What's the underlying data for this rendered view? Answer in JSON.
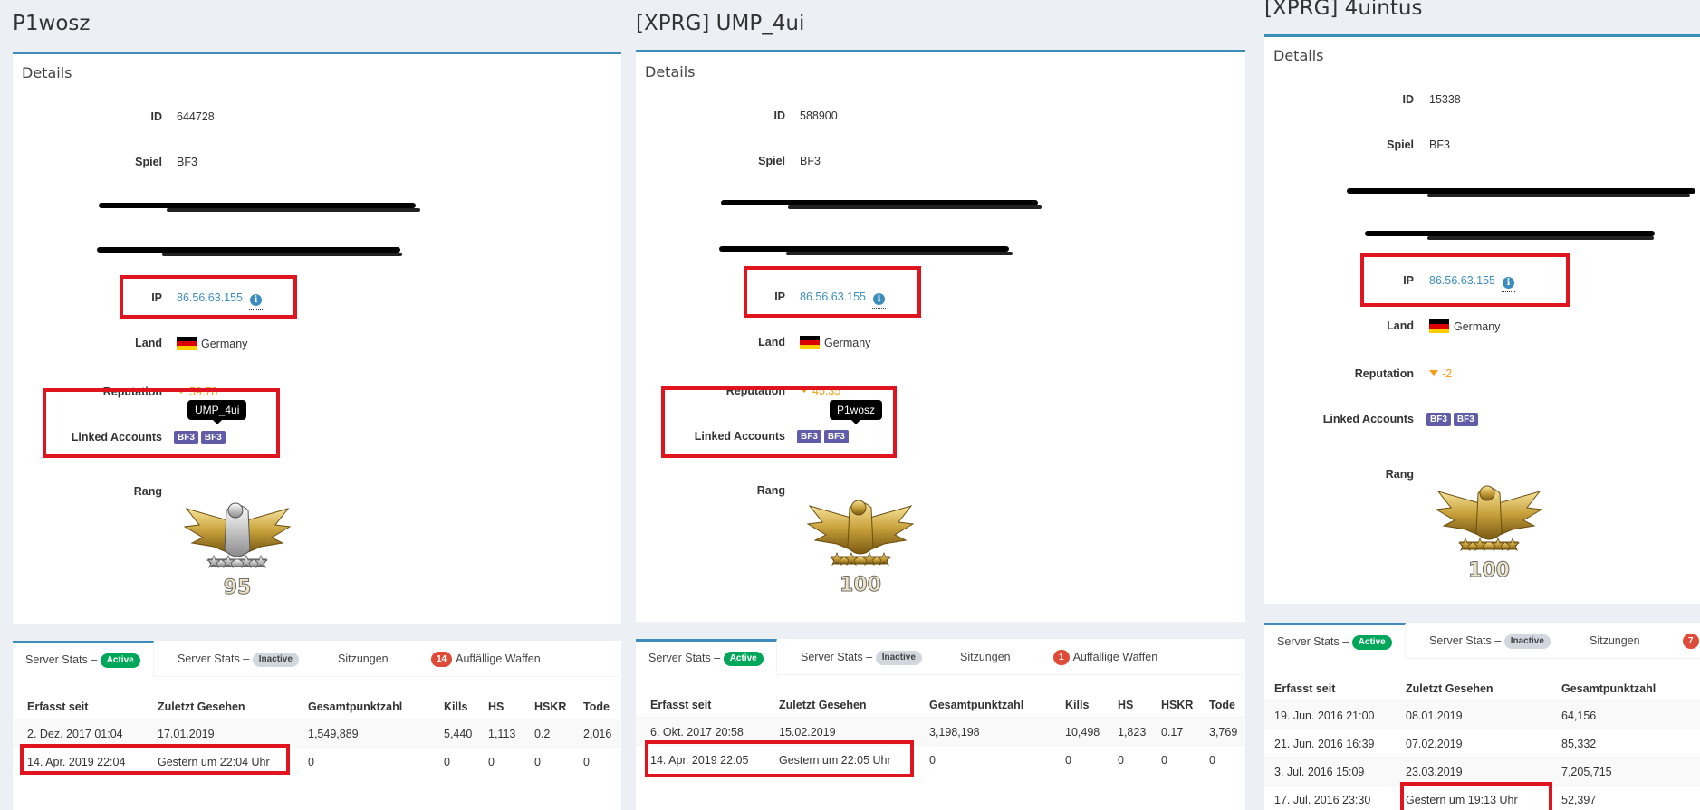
{
  "columns": [
    {
      "title": "P1wosz",
      "details_title": "Details",
      "labels": {
        "id": "ID",
        "game": "Spiel",
        "ip": "IP",
        "country": "Land",
        "reputation": "Reputation",
        "linked": "Linked Accounts",
        "rank": "Rang"
      },
      "id": "644728",
      "game": "BF3",
      "ip": "86.56.63.155",
      "country": "Germany",
      "reputation": "59.78",
      "linked_badges": [
        "BF3",
        "BF3"
      ],
      "tooltip": "UMP_4ui",
      "rank": "95",
      "tabs": [
        {
          "text": "Server Stats –",
          "label": "Active"
        },
        {
          "text": "Server Stats –",
          "label": "Inactive"
        },
        {
          "text": "Sitzungen"
        },
        {
          "count": "14",
          "text": "Auffällige Waffen"
        }
      ],
      "table_headers": [
        "Erfasst seit",
        "Zuletzt Gesehen",
        "Gesamtpunktzahl",
        "Kills",
        "HS",
        "HSKR",
        "Tode"
      ],
      "rows": [
        [
          "2. Dez. 2017 01:04",
          "17.01.2019",
          "1,549,889",
          "5,440",
          "1,113",
          "0.2",
          "2,016"
        ],
        [
          "14. Apr. 2019 22:04",
          "Gestern um 22:04 Uhr",
          "0",
          "0",
          "0",
          "0",
          "0"
        ]
      ]
    },
    {
      "title": "[XPRG] UMP_4ui",
      "details_title": "Details",
      "labels": {
        "id": "ID",
        "game": "Spiel",
        "ip": "IP",
        "country": "Land",
        "reputation": "Reputation",
        "linked": "Linked Accounts",
        "rank": "Rang"
      },
      "id": "588900",
      "game": "BF3",
      "ip": "86.56.63.155",
      "country": "Germany",
      "reputation": "45.35",
      "linked_badges": [
        "BF3",
        "BF3"
      ],
      "tooltip": "P1wosz",
      "rank": "100",
      "tabs": [
        {
          "text": "Server Stats –",
          "label": "Active"
        },
        {
          "text": "Server Stats –",
          "label": "Inactive"
        },
        {
          "text": "Sitzungen"
        },
        {
          "count": "1",
          "text": "Auffällige Waffen"
        }
      ],
      "table_headers": [
        "Erfasst seit",
        "Zuletzt Gesehen",
        "Gesamtpunktzahl",
        "Kills",
        "HS",
        "HSKR",
        "Tode"
      ],
      "rows": [
        [
          "6. Okt. 2017 20:58",
          "15.02.2019",
          "3,198,198",
          "10,498",
          "1,823",
          "0.17",
          "3,769"
        ],
        [
          "14. Apr. 2019 22:05",
          "Gestern um 22:05 Uhr",
          "0",
          "0",
          "0",
          "0",
          "0"
        ]
      ]
    },
    {
      "title": "[XPRG] 4uintus",
      "details_title": "Details",
      "labels": {
        "id": "ID",
        "game": "Spiel",
        "ip": "IP",
        "country": "Land",
        "reputation": "Reputation",
        "linked": "Linked Accounts",
        "rank": "Rang"
      },
      "id": "15338",
      "game": "BF3",
      "ip": "86.56.63.155",
      "country": "Germany",
      "reputation": "-2",
      "linked_badges": [
        "BF3",
        "BF3"
      ],
      "rank": "100",
      "tabs": [
        {
          "text": "Server Stats –",
          "label": "Active"
        },
        {
          "text": "Server Stats –",
          "label": "Inactive"
        },
        {
          "text": "Sitzungen"
        },
        {
          "count": "7"
        }
      ],
      "table_headers": [
        "Erfasst seit",
        "Zuletzt Gesehen",
        "Gesamtpunktzahl"
      ],
      "rows": [
        [
          "19. Jun. 2016 21:00",
          "08.01.2019",
          "64,156"
        ],
        [
          "21. Jun. 2016 16:39",
          "07.02.2019",
          "85,332"
        ],
        [
          "3. Jul. 2016 15:09",
          "23.03.2019",
          "7,205,715"
        ],
        [
          "17. Jul. 2016 23:30",
          "Gestern um 19:13 Uhr",
          "52,397"
        ]
      ]
    }
  ],
  "colors": {
    "accent": "#3c8dbc",
    "highlight": "#e0141e",
    "badge": "#605ca8",
    "active": "#00a65a",
    "inactive": "#d2d6de",
    "danger": "#dd4b39",
    "warning": "#f39c12"
  },
  "icons": [
    "info-icon",
    "germany-flag-icon",
    "caret-down-icon",
    "rank-insignia-icon"
  ]
}
